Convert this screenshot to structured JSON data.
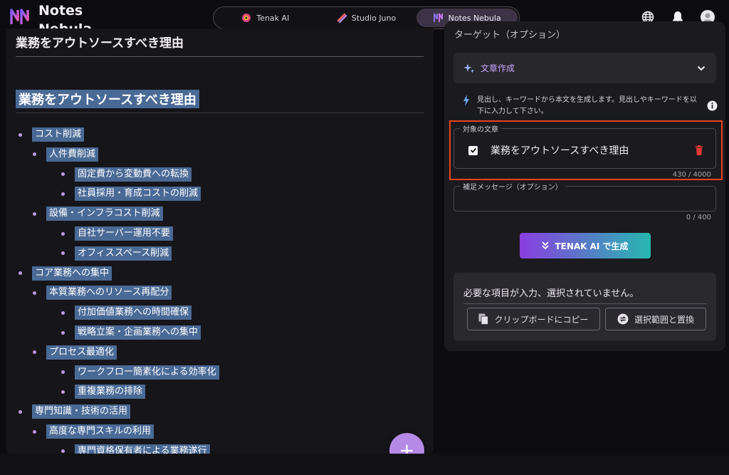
{
  "app": {
    "name": "Notes Nebula",
    "logo_colors": [
      "#7a5cff",
      "#ff5ca8"
    ]
  },
  "tabs": [
    {
      "label": "Tenak AI",
      "icon": "tenak-ai-icon",
      "active": false
    },
    {
      "label": "Studio Juno",
      "icon": "studio-juno-icon",
      "active": false
    },
    {
      "label": "Notes Nebula",
      "icon": "notes-nebula-icon",
      "active": true
    }
  ],
  "header_icons": [
    "globe-icon",
    "bell-icon",
    "user-avatar-icon"
  ],
  "editor": {
    "title": "業務をアウトソースすべき理由",
    "heading": "業務をアウトソースすべき理由",
    "items": [
      {
        "level": 1,
        "text": "コスト削減"
      },
      {
        "level": 2,
        "text": "人件費削減"
      },
      {
        "level": 3,
        "text": "固定費から変動費への転換"
      },
      {
        "level": 3,
        "text": "社員採用・育成コストの削減"
      },
      {
        "level": 2,
        "text": "設備・インフラコスト削減"
      },
      {
        "level": 3,
        "text": "自社サーバー運用不要"
      },
      {
        "level": 3,
        "text": "オフィススペース削減"
      },
      {
        "level": 1,
        "text": "コア業務への集中"
      },
      {
        "level": 2,
        "text": "本質業務へのリソース再配分"
      },
      {
        "level": 3,
        "text": "付加価値業務への時間確保"
      },
      {
        "level": 3,
        "text": "戦略立案・企画業務への集中"
      },
      {
        "level": 2,
        "text": "プロセス最適化"
      },
      {
        "level": 3,
        "text": "ワークフロー簡素化による効率化"
      },
      {
        "level": 3,
        "text": "重複業務の排除"
      },
      {
        "level": 1,
        "text": "専門知識・技術の活用"
      },
      {
        "level": 2,
        "text": "高度な専門スキルの利用"
      },
      {
        "level": 3,
        "text": "専門資格保有者による業務遂行"
      }
    ],
    "fab_label": "+"
  },
  "panel": {
    "target_label": "ターゲット（オプション）",
    "mode_label": "文章作成",
    "hint": "見出し、キーワードから本文を生成します。見出しやキーワードを以下に入力して下さい。",
    "target_legend": "対象の文章",
    "target_text": "業務をアウトソースすべき理由",
    "target_counter": "430 / 4000",
    "supplement_legend": "補足メッセージ（オプション）",
    "supplement_value": "",
    "supplement_counter": "0 / 400",
    "generate_label": "TENAK AI で生成",
    "status_message": "必要な項目が入力、選択されていません。",
    "copy_label": "クリップボードにコピー",
    "replace_label": "選択範囲と置換"
  },
  "colors": {
    "accent": "#b48ae6",
    "selection": "#4a6a96",
    "highlight": "#e8441b",
    "danger": "#e53935"
  }
}
